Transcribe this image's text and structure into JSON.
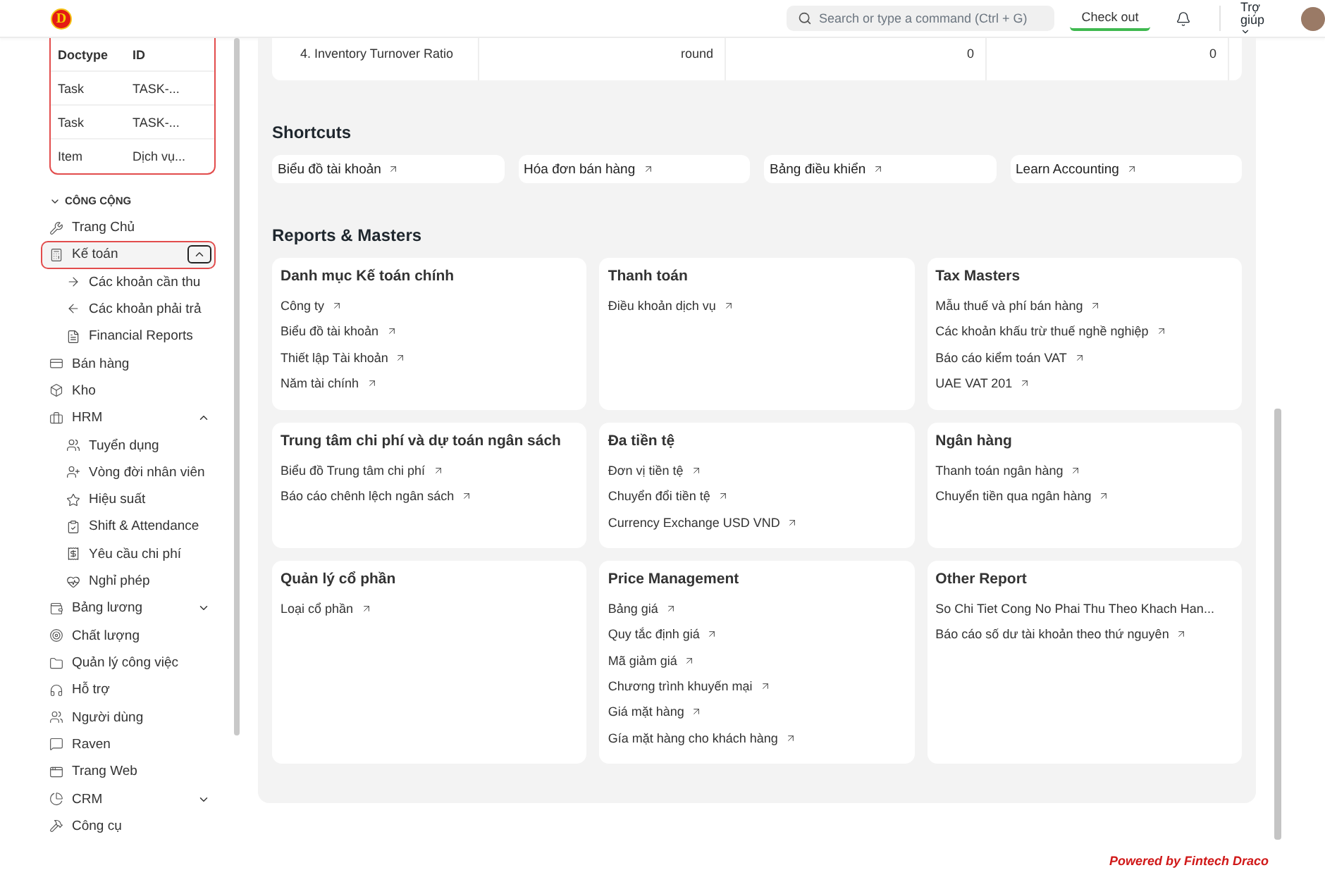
{
  "topbar": {
    "logo": "D",
    "search": {
      "placeholder": "Search or type a command (Ctrl + G)"
    },
    "checkout": "Check out",
    "help": "Trợ giúp"
  },
  "recent": {
    "columns": [
      "Doctype",
      "ID"
    ],
    "rows": [
      {
        "doctype": "Task",
        "id": "TASK-..."
      },
      {
        "doctype": "Task",
        "id": "TASK-..."
      },
      {
        "doctype": "Item",
        "id": "Dịch vụ..."
      }
    ]
  },
  "sidebar": {
    "section": "CÔNG CỘNG",
    "expanded": true,
    "items": [
      {
        "label": "Trang Chủ",
        "selected": false
      },
      {
        "label": "Kế toán",
        "selected": true,
        "expanded": true,
        "children": [
          {
            "label": "Các khoản cần thu",
            "selected": false
          },
          {
            "label": "Các khoản phải trả",
            "selected": false
          },
          {
            "label": "Financial Reports",
            "selected": false
          }
        ]
      },
      {
        "label": "Bán hàng",
        "selected": false
      },
      {
        "label": "Kho",
        "selected": false
      },
      {
        "label": "HRM",
        "selected": false,
        "expanded": true,
        "children": [
          {
            "label": "Tuyển dụng",
            "selected": false
          },
          {
            "label": "Vòng đời nhân viên",
            "selected": false
          },
          {
            "label": "Hiệu suất",
            "selected": false
          },
          {
            "label": "Shift & Attendance",
            "selected": false
          },
          {
            "label": "Yêu cầu chi phí",
            "selected": false
          },
          {
            "label": "Nghỉ phép",
            "selected": false
          }
        ]
      },
      {
        "label": "Bảng lương",
        "selected": false,
        "expanded": false
      },
      {
        "label": "Chất lượng",
        "selected": false
      },
      {
        "label": "Quản lý công việc",
        "selected": false
      },
      {
        "label": "Hỗ trợ",
        "selected": false
      },
      {
        "label": "Người dùng",
        "selected": false
      },
      {
        "label": "Raven",
        "selected": false
      },
      {
        "label": "Trang Web",
        "selected": false
      },
      {
        "label": "CRM",
        "selected": false,
        "expanded": false
      },
      {
        "label": "Công cụ",
        "selected": false
      }
    ]
  },
  "table_row": [
    "4. Inventory Turnover Ratio",
    "round",
    "0",
    "0"
  ],
  "shortcuts": {
    "title": "Shortcuts",
    "items": [
      "Biểu đồ tài khoản",
      "Hóa đơn bán hàng",
      "Bảng điều khiển",
      "Learn Accounting"
    ]
  },
  "reports": {
    "title": "Reports & Masters",
    "cards": [
      {
        "title": "Danh mục Kế toán chính",
        "links": [
          "Công ty",
          "Biểu đồ tài khoản",
          "Thiết lập Tài khoản",
          "Năm tài chính"
        ]
      },
      {
        "title": "Thanh toán",
        "links": [
          "Điều khoản dịch vụ"
        ]
      },
      {
        "title": "Tax Masters",
        "links": [
          "Mẫu thuế và phí bán hàng",
          "Các khoản khấu trừ thuế nghề nghiệp",
          "Báo cáo kiểm toán VAT",
          "UAE VAT 201"
        ]
      },
      {
        "title": "Trung tâm chi phí và dự toán ngân sách",
        "links": [
          "Biểu đồ Trung tâm chi phí",
          "Báo cáo chênh lệch ngân sách"
        ]
      },
      {
        "title": "Đa tiền tệ",
        "links": [
          "Đơn vị tiền tệ",
          "Chuyển đổi tiền tệ",
          "Currency Exchange USD VND"
        ]
      },
      {
        "title": "Ngân hàng",
        "links": [
          "Thanh toán ngân hàng",
          "Chuyển tiền qua ngân hàng"
        ]
      },
      {
        "title": "Quản lý cổ phần",
        "links": [
          "Loại cổ phần"
        ]
      },
      {
        "title": "Price Management",
        "links": [
          "Bảng giá",
          "Quy tắc định giá",
          "Mã giảm giá",
          "Chương trình khuyến mại",
          "Giá mặt hàng",
          "Gía mặt hàng cho khách hàng"
        ]
      },
      {
        "title": "Other Report",
        "links": [
          "So Chi Tiet Cong No Phai Thu Theo Khach Han...",
          "Báo cáo số dư tài khoản theo thứ nguyên"
        ]
      }
    ]
  },
  "footer": "Powered by Fintech Draco"
}
